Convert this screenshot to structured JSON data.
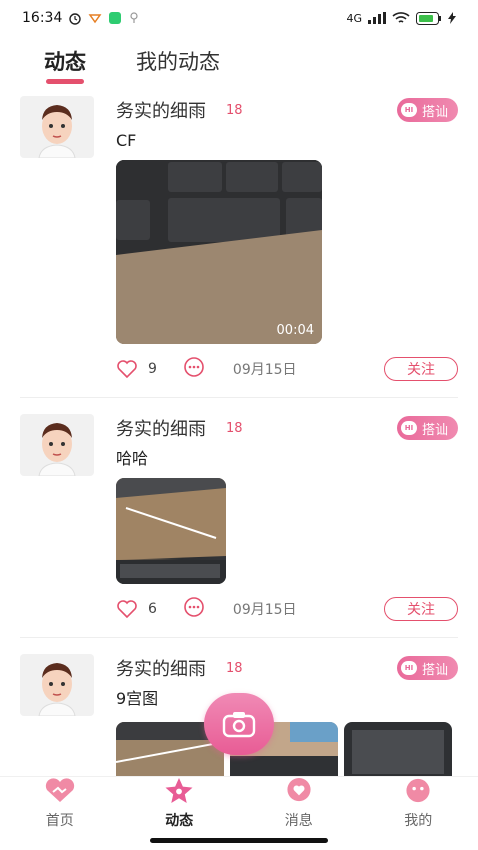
{
  "status_bar": {
    "time": "16:34",
    "network": "4G"
  },
  "tabs": [
    {
      "label": "动态",
      "active": true
    },
    {
      "label": "我的动态",
      "active": false
    }
  ],
  "posts": [
    {
      "username": "务实的细雨",
      "age": "18",
      "chat_label": "搭讪",
      "text": "CF",
      "media": "video",
      "duration": "00:04",
      "likes": "9",
      "date": "09月15日",
      "follow_label": "关注"
    },
    {
      "username": "务实的细雨",
      "age": "18",
      "chat_label": "搭讪",
      "text": "哈哈",
      "media": "photo",
      "likes": "6",
      "date": "09月15日",
      "follow_label": "关注"
    },
    {
      "username": "务实的细雨",
      "age": "18",
      "chat_label": "搭讪",
      "text": "9宫图",
      "media": "grid"
    }
  ],
  "bottom_nav": [
    {
      "label": "首页",
      "icon": "heart-handshake-icon",
      "active": false
    },
    {
      "label": "动态",
      "icon": "star-icon",
      "active": true
    },
    {
      "label": "消息",
      "icon": "message-heart-icon",
      "active": false
    },
    {
      "label": "我的",
      "icon": "face-icon",
      "active": false
    }
  ],
  "colors": {
    "accent": "#e4506d",
    "chat_gradient": "#e96a9a"
  }
}
